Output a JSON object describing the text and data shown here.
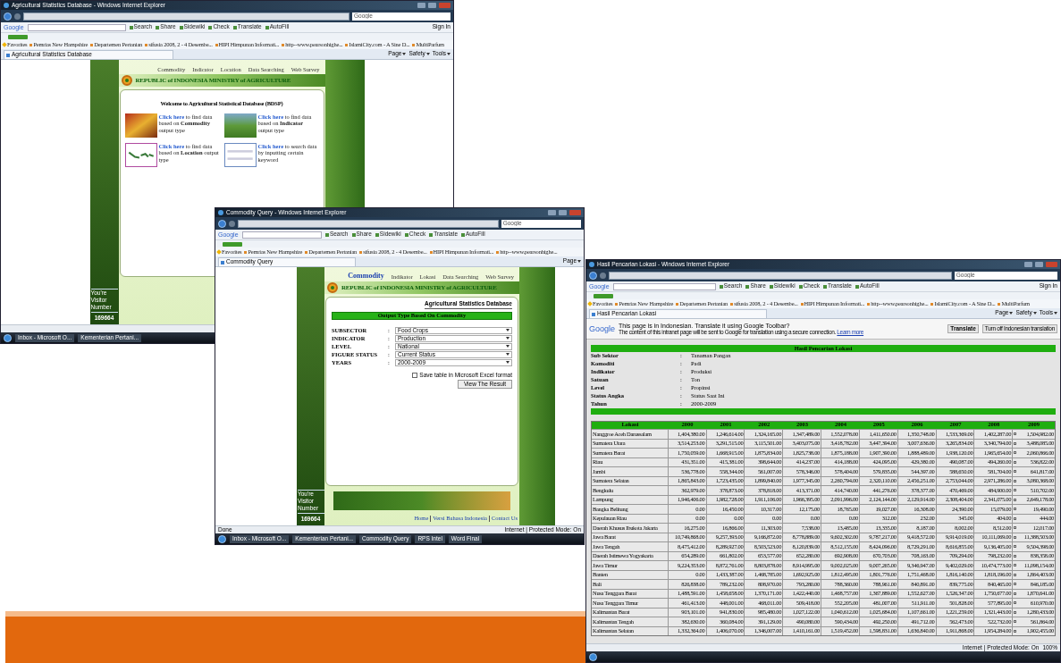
{
  "windows": [
    {
      "kind": "home",
      "title": "Agricultural Statistics Database - Windows Internet Explorer",
      "search_placeholder": "Google",
      "google": {
        "logo": "Google",
        "items": [
          "Search",
          "Share",
          "Sidewiki",
          "Check",
          "Translate",
          "AutoFill"
        ],
        "sign_in": "Sign In"
      },
      "favorites": [
        "Favorites",
        "Pemrias New Hampshire",
        "Departemen Pertanian",
        "sifusia 2008, 2 - 4 Desembe...",
        "HIPI Himpunan Informati...",
        "http--www.pearsonhighe...",
        "IslamiCity.com - A Sine D...",
        "MultiParfum"
      ],
      "tab": "Agricultural Statistics Database",
      "command_bar": [
        "Page",
        "Safety",
        "Tools"
      ],
      "site": {
        "nav": [
          {
            "label": "Commodity",
            "selected": false
          },
          {
            "label": "Indicator",
            "selected": false
          },
          {
            "label": "Location",
            "selected": false
          },
          {
            "label": "Data Searching",
            "selected": false
          },
          {
            "label": "Web Survey",
            "selected": false
          }
        ],
        "banner": "REPUBLIC of INDONESIA MINISTRY of AGRICULTURE",
        "welcome": "Welcome to Agricultural Statistical Database (BDSP)",
        "options": [
          {
            "kind": "commodity",
            "link": "Click here",
            "text": "to find data based on **Commodity** output type"
          },
          {
            "kind": "indicator",
            "link": "Click here",
            "text": "to find data based on **Indicator** output type"
          },
          {
            "kind": "location",
            "link": "Click here",
            "text": "to find data based on **Location** output type"
          },
          {
            "kind": "search",
            "link": "Click here",
            "text": "to search data by inputting certain keyword"
          }
        ],
        "visitor_label": "You're Visitor Number",
        "visitor_count": "169664"
      },
      "taskbar": [
        "Inbox - Microsoft O...",
        "Kementerian Pertani..."
      ]
    },
    {
      "kind": "query",
      "title": "Commodity Query - Windows Internet Explorer",
      "search_placeholder": "Google",
      "google": {
        "logo": "Google",
        "items": [
          "Search",
          "Share",
          "Sidewiki",
          "Check",
          "Translate",
          "AutoFill"
        ]
      },
      "favorites": [
        "Favorites",
        "Pemrias New Hampshire",
        "Departemen Pertanian",
        "sifusia 2008, 2 - 4 Desembe...",
        "HIPI Himpunan Informati...",
        "http--www.pearsonhighe..."
      ],
      "tab": "Commodity Query",
      "command_bar": [
        "Page"
      ],
      "site": {
        "nav": [
          {
            "label": "Commodity",
            "selected": true
          },
          {
            "label": "Indikator",
            "selected": false
          },
          {
            "label": "Lokasi",
            "selected": false
          },
          {
            "label": "Data Searching",
            "selected": false
          },
          {
            "label": "Web Survey",
            "selected": false
          }
        ],
        "banner": "REPUBLIC of INDONESIA MINISTRY of AGRICULTURE",
        "db_title": "Agricultural Statistics Database",
        "form_title": "Output Type Based On Commodity",
        "fields": [
          {
            "label": "SUBSECTOR",
            "colon": ":",
            "value": "Food Crops"
          },
          {
            "label": "INDICATOR",
            "colon": ":",
            "value": "Production"
          },
          {
            "label": "LEVEL",
            "colon": ":",
            "value": "National"
          },
          {
            "label": "FIGURE STATUS",
            "colon": ":",
            "value": "Current Status"
          },
          {
            "label": "YEARS",
            "colon": ":",
            "value": "2000-2009"
          }
        ],
        "excel": {
          "label": "Save table in Microsoft Excel format",
          "checked": false
        },
        "button": "View The Result",
        "footer_links": [
          "Home",
          "Versi Bahasa Indonesia",
          "Contact Us"
        ],
        "visitor_label": "You're Visitor Number",
        "visitor_count": "169664"
      },
      "status": "Done",
      "zone": "Internet | Protected Mode: On",
      "taskbar": [
        "Inbox - Microsoft O...",
        "Kementerian Pertani...",
        "Commodity Query",
        "RPS Intel",
        "Word Final"
      ]
    },
    {
      "kind": "result",
      "title": "Hasil Pencarian Lokasi - Windows Internet Explorer",
      "search_placeholder": "Google",
      "google": {
        "logo": "Google",
        "items": [
          "Search",
          "Share",
          "Sidewiki",
          "Check",
          "Translate",
          "AutoFill"
        ],
        "sign_in": "Sign In"
      },
      "favorites": [
        "Favorites",
        "Pemrias New Hampshire",
        "Departemen Pertanian",
        "sifusia 2008, 2 - 4 Desembe...",
        "HIPI Himpunan Informati...",
        "http--www.pearsonhighe...",
        "IslamiCity.com - A Sine D...",
        "MultiParfum"
      ],
      "tab": "Hasil Pencarian Lokasi",
      "command_bar": [
        "Page",
        "Safety",
        "Tools"
      ],
      "translate": {
        "logo": "Google",
        "question": "This page is in Indonesian.  Translate it using Google Toolbar?",
        "note": "The content of this intranet page will be sent to Google for translation using a secure connection.",
        "link": "Learn more",
        "buttons": [
          "Translate",
          "Turn off Indonesian translation"
        ]
      },
      "result": {
        "title": "Hasil Pencarian Lokasi",
        "info": [
          {
            "label": "Sub Sektor",
            "colon": ":",
            "value": "Tanaman Pangan"
          },
          {
            "label": "Komoditi",
            "colon": ":",
            "value": "Padi"
          },
          {
            "label": "Indikator",
            "colon": ":",
            "value": "Produksi"
          },
          {
            "label": "Satuan",
            "colon": ":",
            "value": "Ton"
          },
          {
            "label": "Level",
            "colon": ":",
            "value": "Propinsi"
          },
          {
            "label": "Status Angka",
            "colon": ":",
            "value": "Status Saat Ini"
          },
          {
            "label": "Tahun",
            "colon": ":",
            "value": "2000-2009"
          }
        ],
        "columns": [
          "Lokasi",
          "2000",
          "2001",
          "2002",
          "2003",
          "2004",
          "2005",
          "2006",
          "2007",
          "2008",
          "2009"
        ],
        "rows": [
          [
            "Nanggroe Aceh Darussalam",
            "1,404,380.00",
            "1,246,614.00",
            "1,324,165.00",
            "1,347,489.00",
            "1,552,078.00",
            "1,411,650.00",
            "1,350,748.00",
            "1,533,369.00",
            "1,402,287.00",
            "1,504,982.00"
          ],
          [
            "Sumatera Utara",
            "3,514,253.00",
            "3,291,515.00",
            "3,115,501.00",
            "3,403,075.00",
            "3,418,782.00",
            "3,447,394.00",
            "3,007,636.00",
            "3,265,834.00",
            "3,340,794.00",
            "3,488,085.00"
          ],
          [
            "Sumatera Barat",
            "1,750,059.00",
            "1,668,915.00",
            "1,875,834.00",
            "1,825,738.00",
            "1,875,188.00",
            "1,907,390.00",
            "1,888,489.00",
            "1,938,120.00",
            "1,965,654.00",
            "2,060,866.00"
          ],
          [
            "Riau",
            "431,351.00",
            "415,381.00",
            "398,644.00",
            "414,237.00",
            "414,188.00",
            "424,095.00",
            "429,380.00",
            "490,087.00",
            "494,260.00",
            "536,822.00"
          ],
          [
            "Jambi",
            "536,778.00",
            "558,344.00",
            "561,007.00",
            "578,346.00",
            "578,404.00",
            "579,835.00",
            "544,397.00",
            "588,650.00",
            "581,704.00",
            "641,817.00"
          ],
          [
            "Sumatera Selatan",
            "1,865,843.00",
            "1,723,435.00",
            "1,899,840.00",
            "1,977,345.00",
            "2,260,794.00",
            "2,320,110.00",
            "2,456,251.00",
            "2,753,044.00",
            "2,971,286.00",
            "3,080,368.00"
          ],
          [
            "Bengkulu",
            "362,979.00",
            "378,873.00",
            "378,818.00",
            "413,371.00",
            "414,740.00",
            "441,276.00",
            "378,377.00",
            "470,469.00",
            "484,900.00",
            "510,702.00"
          ],
          [
            "Lampung",
            "1,946,406.00",
            "1,982,728.00",
            "1,911,106.00",
            "1,966,395.00",
            "2,091,996.00",
            "2,124,144.00",
            "2,129,914.00",
            "2,308,404.00",
            "2,341,075.00",
            "2,649,178.00"
          ],
          [
            "Bangka Belitung",
            "0.00",
            "16,450.00",
            "10,317.00",
            "12,175.00",
            "18,765.00",
            "19,027.00",
            "16,308.00",
            "24,390.00",
            "15,079.00",
            "19,490.00"
          ],
          [
            "Kepulauan Riau",
            "0.00",
            "0.00",
            "0.00",
            "0.00",
            "0.00",
            "312.00",
            "232.00",
            "345.00",
            "404.00",
            "444.00"
          ],
          [
            "Daerah Khusus Ibukota Jakarta",
            "16,275.00",
            "16,866.00",
            "11,303.00",
            "7,538.00",
            "13,485.00",
            "13,335.00",
            "8,187.00",
            "8,002.00",
            "8,512.00",
            "12,017.00"
          ],
          [
            "Jawa Barat",
            "10,749,868.00",
            "9,257,393.00",
            "9,166,872.00",
            "8,778,889.00",
            "9,602,302.00",
            "9,787,217.00",
            "9,418,572.00",
            "9,914,019.00",
            "10,111,069.00",
            "11,388,503.00"
          ],
          [
            "Jawa Tengah",
            "8,475,412.00",
            "8,289,927.00",
            "8,503,523.00",
            "8,120,839.00",
            "8,512,155.00",
            "8,424,096.00",
            "8,729,291.00",
            "8,616,855.00",
            "9,136,405.00",
            "9,504,398.00"
          ],
          [
            "Daerah Istimewa Yogyakarta",
            "654,289.00",
            "661,802.00",
            "653,577.00",
            "652,280.00",
            "692,908.00",
            "670,703.00",
            "708,163.00",
            "709,294.00",
            "798,232.00",
            "838,358.00"
          ],
          [
            "Jawa Timur",
            "9,224,353.00",
            "8,872,761.00",
            "8,803,878.00",
            "8,914,995.00",
            "9,002,025.00",
            "9,007,265.00",
            "9,346,947.00",
            "9,402,029.00",
            "10,474,773.00",
            "11,098,154.00"
          ],
          [
            "Banten",
            "0.00",
            "1,433,387.00",
            "1,468,785.00",
            "1,692,925.00",
            "1,812,495.00",
            "1,801,776.00",
            "1,751,468.00",
            "1,816,140.00",
            "1,818,196.00",
            "1,864,403.00"
          ],
          [
            "Bali",
            "826,838.00",
            "789,232.00",
            "808,970.00",
            "793,280.00",
            "788,360.00",
            "788,961.00",
            "840,891.00",
            "839,775.00",
            "840,465.00",
            "846,185.00"
          ],
          [
            "Nusa Tenggara Barat",
            "1,488,591.00",
            "1,458,658.00",
            "1,370,171.00",
            "1,422,440.00",
            "1,468,757.00",
            "1,367,889.00",
            "1,552,627.00",
            "1,526,347.00",
            "1,750,677.00",
            "1,870,641.00"
          ],
          [
            "Nusa Tenggara Timur",
            "461,413.00",
            "448,001.00",
            "468,011.00",
            "509,418.00",
            "552,205.00",
            "481,007.00",
            "511,911.00",
            "501,828.00",
            "577,895.00",
            "610,970.00"
          ],
          [
            "Kalimantan Barat",
            "903,101.00",
            "941,830.00",
            "985,480.00",
            "1,027,122.00",
            "1,040,612.00",
            "1,025,684.00",
            "1,107,661.00",
            "1,221,259.00",
            "1,321,443.00",
            "1,280,433.00"
          ],
          [
            "Kalimantan Tengah",
            "382,630.00",
            "360,084.00",
            "391,129.00",
            "490,080.00",
            "590,434.00",
            "492,250.00",
            "491,712.00",
            "562,473.00",
            "522,732.00",
            "561,864.00"
          ],
          [
            "Kalimantan Selatan",
            "1,332,364.00",
            "1,406,070.00",
            "1,346,007.00",
            "1,410,161.00",
            "1,519,452.00",
            "1,598,831.00",
            "1,636,840.00",
            "1,911,868.00",
            "1,954,284.00",
            "1,902,455.00"
          ]
        ]
      },
      "zone": "Internet | Protected Mode: On",
      "zoom": "100%"
    }
  ]
}
